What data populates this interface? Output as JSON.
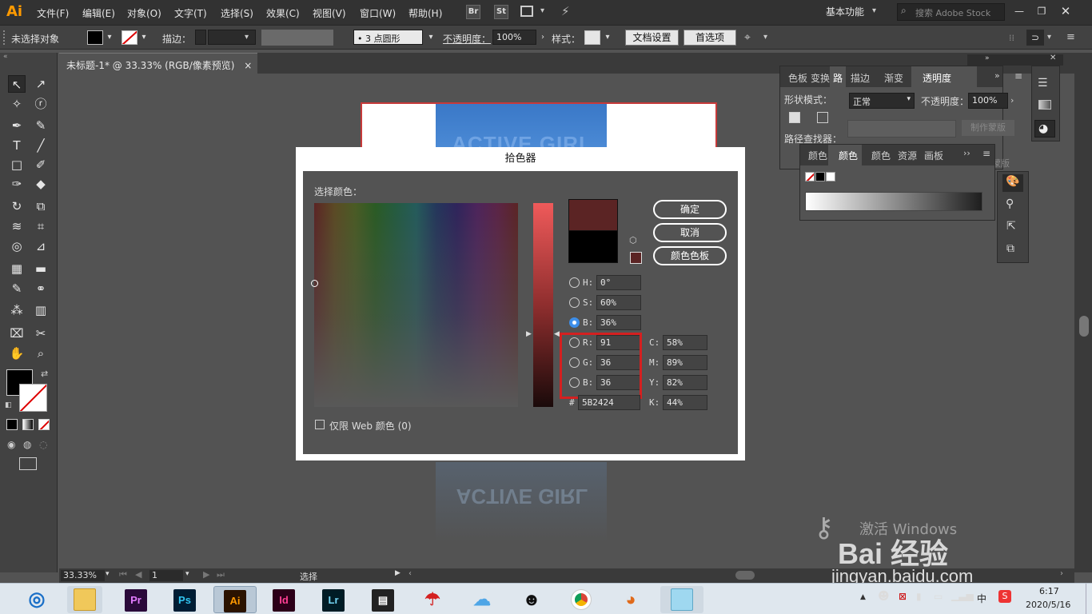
{
  "app": {
    "logo": "Ai"
  },
  "menu": [
    "文件(F)",
    "编辑(E)",
    "对象(O)",
    "文字(T)",
    "选择(S)",
    "效果(C)",
    "视图(V)",
    "窗口(W)",
    "帮助(H)"
  ],
  "menubar_icons": {
    "bridge": "Br",
    "stock": "St"
  },
  "workspace": {
    "label": "基本功能"
  },
  "search": {
    "placeholder": "搜索 Adobe Stock"
  },
  "controlbar": {
    "no_selection": "未选择对象",
    "stroke_label": "描边：",
    "brush_value": "3 点圆形",
    "opacity_label": "不透明度：",
    "opacity_value": "100%",
    "style_label": "样式：",
    "doc_settings": "文档设置",
    "preferences": "首选项"
  },
  "document_tab": {
    "title": "未标题-1* @ 33.33% (RGB/像素预览)",
    "close": "×"
  },
  "artwork": {
    "text": "ACTIVE GIRL"
  },
  "panels": {
    "top_tabs": [
      "色板",
      "变换",
      "路",
      "描边",
      "渐变",
      "透明度"
    ],
    "shape_mode": "形状模式：",
    "pathfinder": "路径查找器：",
    "blend_mode": "正常",
    "transparency_label": "不透明度：",
    "transparency_value": "100%",
    "make_mask": "制作蒙版",
    "mask_partial": "蒙版",
    "color_tabs": [
      "颜色",
      "颜色",
      "颜色",
      "资源",
      "画板"
    ]
  },
  "dialog": {
    "title": "拾色器",
    "select_color": "选择颜色：",
    "ok": "确定",
    "cancel": "取消",
    "swatches": "颜色色板",
    "fields": {
      "H": "0°",
      "S": "60%",
      "B": "36%",
      "R": "91",
      "G": "36",
      "Bb": "36",
      "hex": "5B2424",
      "C": "58%",
      "M": "89%",
      "Y": "82%",
      "K": "44%"
    },
    "labels": {
      "H": "H:",
      "S": "S:",
      "B": "B:",
      "R": "R:",
      "G": "G:",
      "Bb": "B:",
      "hex": "#",
      "C": "C:",
      "M": "M:",
      "Y": "Y:",
      "K": "K:"
    },
    "web_only": "仅限 Web 颜色 (0)",
    "new_color": "#5b2424",
    "old_color": "#000000"
  },
  "statusbar": {
    "zoom": "33.33%",
    "page": "1",
    "tool": "选择"
  },
  "taskbar": {
    "apps": [
      "Pr",
      "Ps",
      "Ai",
      "Id",
      "Lr"
    ],
    "clock_time": "6:17",
    "clock_date": "2020/5/16",
    "ime": "中"
  },
  "watermark": {
    "line1": "激活 Windows",
    "brand": "Bai 经验",
    "url": "jingyan.baidu.com"
  },
  "colors": {
    "accent": "#3d8ee9",
    "highlight": "#d42020",
    "ai_orange": "#ff9a00"
  }
}
